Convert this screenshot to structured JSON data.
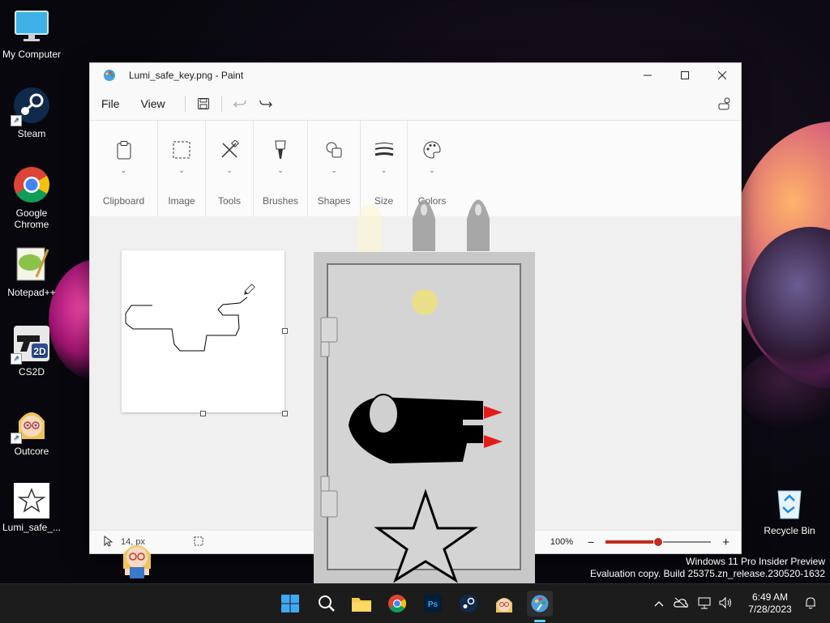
{
  "desktop": {
    "icons": [
      {
        "label": "My Computer",
        "icon": "monitor-icon"
      },
      {
        "label": "Steam",
        "icon": "steam-icon"
      },
      {
        "label": "Google Chrome",
        "icon": "chrome-icon"
      },
      {
        "label": "Notepad++",
        "icon": "notepadpp-icon"
      },
      {
        "label": "CS2D",
        "icon": "cs2d-icon"
      },
      {
        "label": "Outcore",
        "icon": "outcore-icon"
      },
      {
        "label": "Lumi_safe_...",
        "icon": "star-file-icon"
      }
    ],
    "recycle_bin": {
      "label": "Recycle Bin",
      "icon": "recycle-bin-icon"
    },
    "watermark": [
      "Windows 11 Pro Insider Preview",
      "Evaluation copy. Build 25375.zn_release.230520-1632"
    ]
  },
  "paint": {
    "title": "Lumi_safe_key.png - Paint",
    "menu": [
      "File",
      "View"
    ],
    "ribbon_groups": [
      "Clipboard",
      "Image",
      "Tools",
      "Brushes",
      "Shapes",
      "Size",
      "Colors"
    ],
    "status": {
      "coords": "14",
      "size_unit": "px",
      "zoom": "100%",
      "zoom_fraction": 0.5
    },
    "colors": {
      "accent": "#c42b1c",
      "canvas": "#ffffff",
      "background": "#f0f0f0"
    }
  },
  "taskbar": {
    "apps": [
      "start-icon",
      "search-icon",
      "file-explorer-icon",
      "chrome-icon",
      "photoshop-icon",
      "steam-icon",
      "outcore-icon",
      "paint-icon"
    ],
    "time": "6:49 AM",
    "date": "7/28/2023"
  }
}
